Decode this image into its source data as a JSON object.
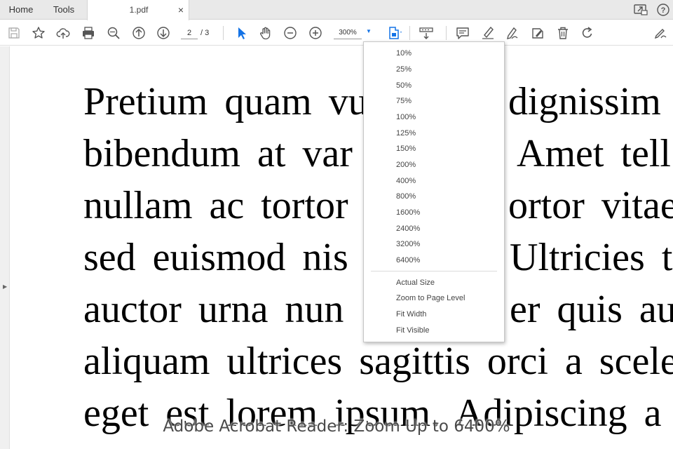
{
  "tabs": {
    "home": "Home",
    "tools": "Tools",
    "document": "1.pdf",
    "close_glyph": "×"
  },
  "window_icons": [
    "share-screen-icon",
    "help-icon"
  ],
  "toolbar": {
    "current_page": "2",
    "page_total": "/ 3",
    "zoom_value": "300%",
    "icons": [
      "save-icon",
      "bookmark-star-icon",
      "upload-cloud-icon",
      "print-icon",
      "zoom-find-icon",
      "page-up-icon",
      "page-down-icon",
      "select-cursor-icon",
      "hand-tool-icon",
      "zoom-out-icon",
      "zoom-in-icon",
      "fit-page-icon",
      "scroll-mode-icon",
      "comment-icon",
      "highlight-icon",
      "draw-icon",
      "fill-sign-icon",
      "delete-icon",
      "rotate-icon",
      "sign-icon"
    ],
    "accent_color": "#1473e6"
  },
  "document_lines": [
    "Pretium quam vu",
    "dignissim",
    "bibendum at var",
    "Amet tell",
    "nullam ac tortor",
    "ortor vitae",
    "sed euismod nis",
    "Ultricies t",
    "auctor urna nun",
    "er quis au",
    "aliquam ultrices sagittis orci a scele",
    "eget est lorem ipsum. Adipiscing a"
  ],
  "zoom_menu": {
    "presets": [
      "10%",
      "25%",
      "50%",
      "75%",
      "100%",
      "125%",
      "150%",
      "200%",
      "400%",
      "800%",
      "1600%",
      "2400%",
      "3200%",
      "6400%"
    ],
    "actions": [
      "Actual Size",
      "Zoom to Page Level",
      "Fit Width",
      "Fit Visible"
    ]
  },
  "caption": "Adobe Acrobat Reader: Zoom Up to 6400%"
}
